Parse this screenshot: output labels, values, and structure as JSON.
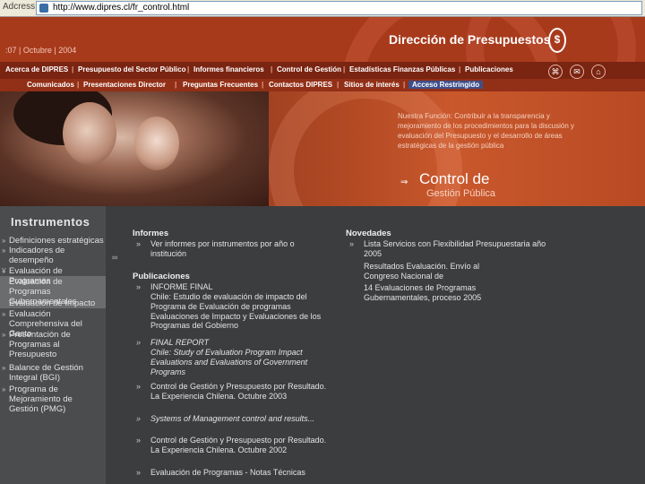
{
  "browser": {
    "address_label": "Adcress",
    "url": "http://www.dipres.cl/fr_control.html"
  },
  "header": {
    "date": ":07 | Octubre | 2004",
    "brand": "Dirección de Presupuestos",
    "seal": "$"
  },
  "nav_primary": [
    "Acerca de DIPRES",
    "Presupuesto del Sector Público",
    "Informes financieros",
    "Control de Gestión",
    "Estadísticas Finanzas Públicas",
    "Publicaciones"
  ],
  "nav_secondary": [
    "Comunicados",
    "Presentaciones Director",
    "Preguntas Frecuentes",
    "Contactos DIPRES",
    "Sitios de interés",
    "Acceso Restringido"
  ],
  "separator": "|",
  "icons": {
    "sitemap": "⌘",
    "mail": "✉",
    "home": "⌂"
  },
  "banner": {
    "mission": "Nuestra Función: Contribuir a la transparencia y mejoramiento de los procedimientos para la discusión y evaluación del Presupuesto y el desarrollo de áreas estratégicas de la gestión pública",
    "arrow": "⇒",
    "title_line1": "Control de",
    "title_line2": "Gestión Pública"
  },
  "sidebar": {
    "title": "Instrumentos",
    "items": [
      {
        "mark": "»",
        "label": "Definiciones estratégicas"
      },
      {
        "mark": "»",
        "label": "Indicadores de desempeño"
      },
      {
        "mark": "¥",
        "label": "Evaluación de Programas"
      },
      {
        "mark": "",
        "label": "Evaluación de Programas Gubernamentales"
      },
      {
        "mark": "",
        "label": "Evaluación de Impacto"
      },
      {
        "mark": "»",
        "label": "Evaluación Comprehensiva del Gasto"
      },
      {
        "mark": "»",
        "label": "Presentación de Programas al Presupuesto"
      },
      {
        "mark": "»",
        "label": "Balance de Gestión Integral (BGI)"
      },
      {
        "mark": "»",
        "label": "Programa de Mejoramiento de Gestión (PMG)"
      }
    ]
  },
  "sidebar_separator": "∞",
  "informes": {
    "heading": "Informes",
    "items": [
      {
        "bullet": "»",
        "text": "Ver informes por instrumentos por año o institución"
      }
    ]
  },
  "publicaciones": {
    "heading": "Publicaciones",
    "items": [
      {
        "bullet": "»",
        "text": "INFORME FINAL"
      },
      {
        "bullet": "",
        "text": "Chile: Estudio de evaluación de impacto del Programa de Evaluación de programas Evaluaciones de Impacto y Evaluaciones de los Programas del Gobierno"
      },
      {
        "bullet": "»",
        "text": "FINAL REPORT"
      },
      {
        "bullet": "",
        "text": "Chile: Study of Evaluation Program Impact Evaluations and Evaluations of Government Programs"
      },
      {
        "bullet": "»",
        "text": "Control de Gestión y Presupuesto por Resultado. La Experiencia Chilena. Octubre 2003"
      },
      {
        "bullet": "»",
        "text": "Systems of Management control and results..."
      },
      {
        "bullet": "»",
        "text": "Control de Gestión y Presupuesto por Resultado. La Experiencia Chilena. Octubre 2002"
      },
      {
        "bullet": "»",
        "text": "Evaluación de Programas - Notas Técnicas"
      }
    ]
  },
  "novedades": {
    "heading": "Novedades",
    "items": [
      {
        "bullet": "»",
        "text": "Lista Servicios con Flexibilidad Presupuestaria año 2005"
      },
      {
        "bullet": "",
        "text": "Resultados Evaluación. Envío al Congreso Nacional de"
      },
      {
        "bullet": "",
        "text": "14 Evaluaciones de Programas Gubernamentales, proceso 2005"
      }
    ]
  }
}
